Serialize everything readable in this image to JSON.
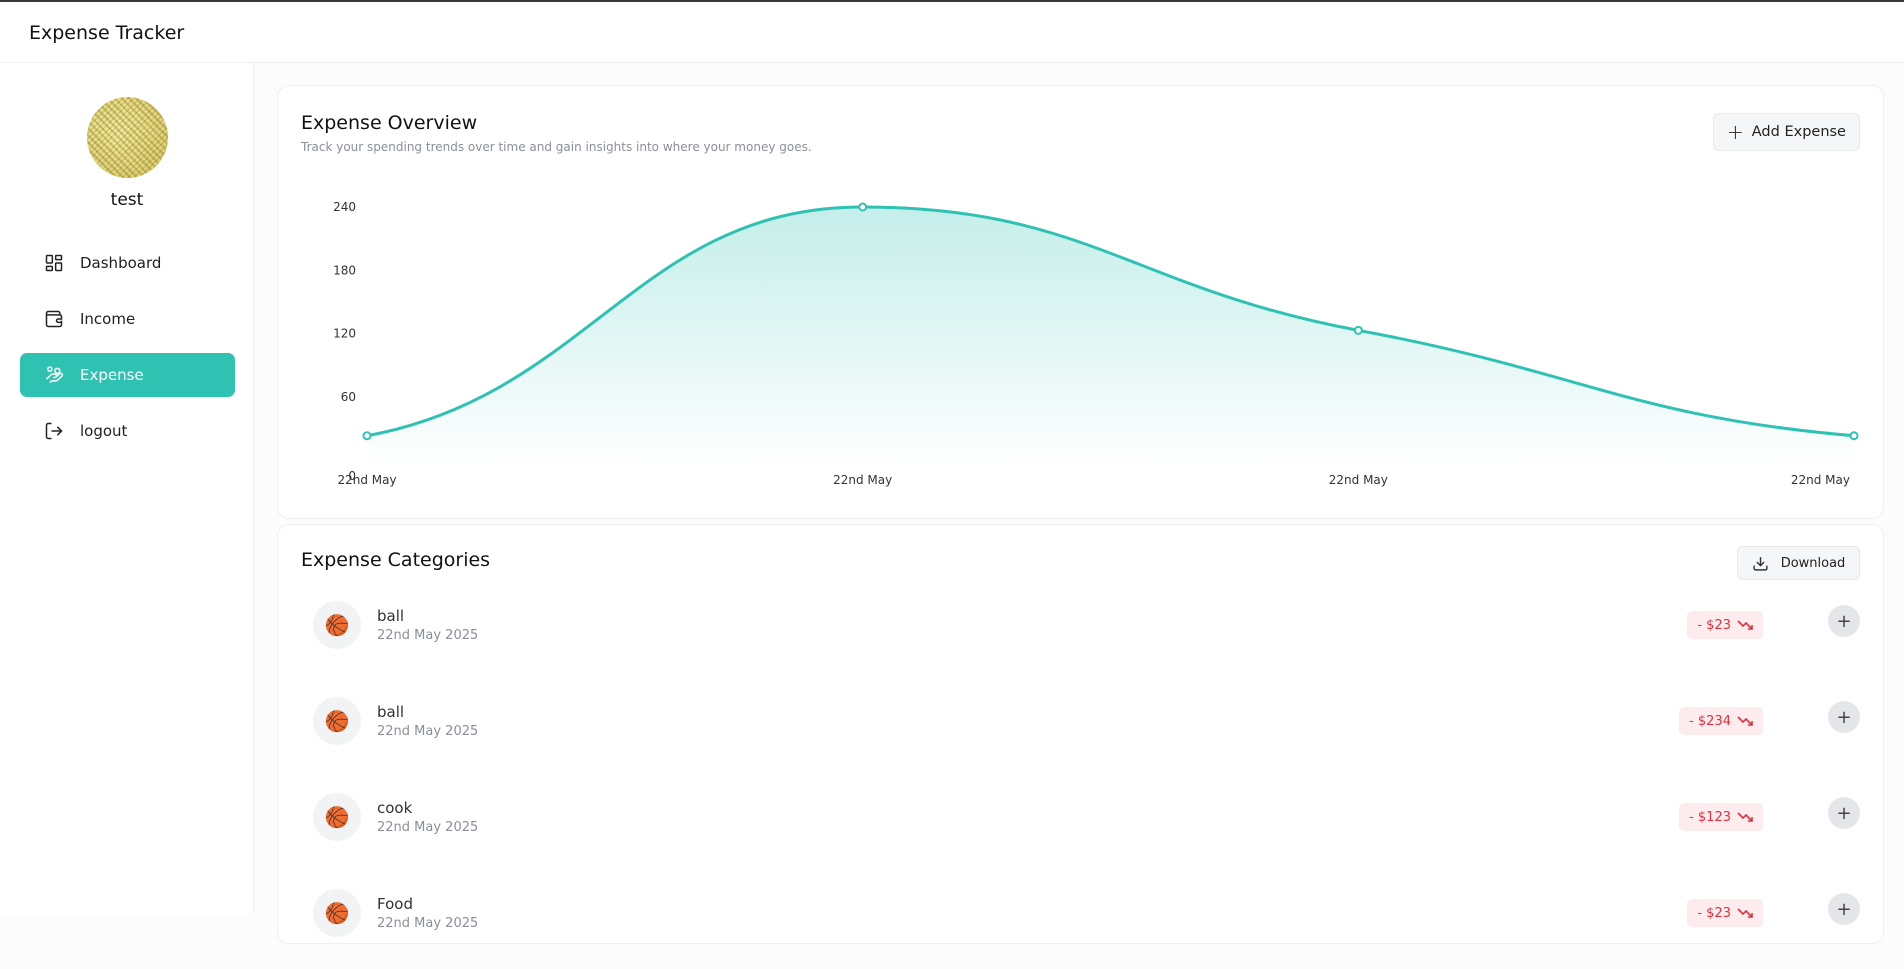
{
  "app": {
    "title": "Expense Tracker"
  },
  "sidebar": {
    "username": "test",
    "items": [
      {
        "label": "Dashboard",
        "icon": "dashboard-icon",
        "active": false
      },
      {
        "label": "Income",
        "icon": "wallet-icon",
        "active": false
      },
      {
        "label": "Expense",
        "icon": "hand-coins-icon",
        "active": true
      },
      {
        "label": "logout",
        "icon": "logout-icon",
        "active": false
      }
    ]
  },
  "overview": {
    "title": "Expense Overview",
    "subtitle": "Track your spending trends over time and gain insights into where your money goes.",
    "add_label": "Add Expense"
  },
  "chart_data": {
    "type": "area",
    "x": [
      "22nd May",
      "22nd May",
      "22nd May",
      "22nd May"
    ],
    "values": [
      23,
      240,
      123,
      23
    ],
    "ylim": [
      0,
      240
    ],
    "yticks": [
      0,
      60,
      120,
      180,
      240
    ],
    "grid": false,
    "line_color": "#2fc2b3",
    "fill_color": "#2fc2b3"
  },
  "categories": {
    "title": "Expense Categories",
    "download_label": "Download",
    "rows": [
      {
        "name": "ball",
        "date": "22nd May 2025",
        "amount": "- $23",
        "icon": "basketball-icon"
      },
      {
        "name": "ball",
        "date": "22nd May 2025",
        "amount": "- $234",
        "icon": "basketball-icon"
      },
      {
        "name": "cook",
        "date": "22nd May 2025",
        "amount": "- $123",
        "icon": "basketball-icon"
      },
      {
        "name": "Food",
        "date": "22nd May 2025",
        "amount": "- $23",
        "icon": "basketball-icon"
      }
    ]
  },
  "colors": {
    "accent": "#2fc2b3",
    "negative": "#e0303f",
    "negative_bg": "#fdecee"
  }
}
